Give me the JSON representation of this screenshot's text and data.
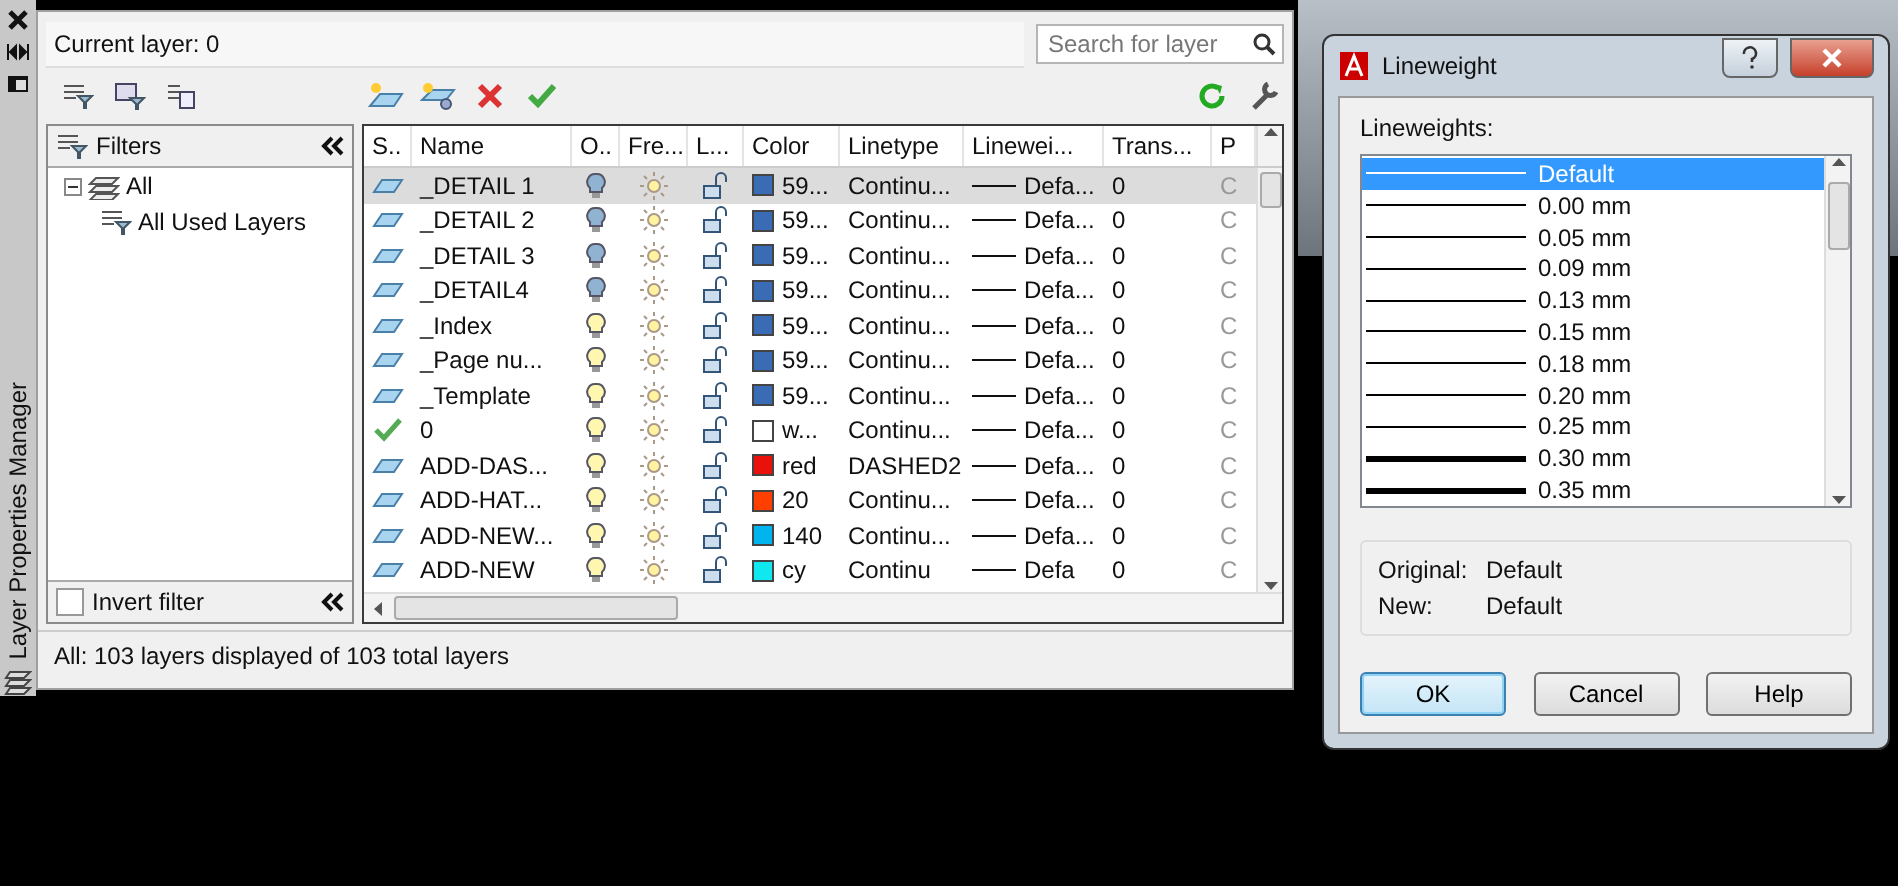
{
  "palette": {
    "side_title": "Layer Properties Manager",
    "current_layer": "Current layer: 0",
    "search": {
      "placeholder": "Search for layer"
    },
    "filters": {
      "title": "Filters",
      "tree": [
        {
          "label": "All",
          "expanded": true,
          "children": [
            {
              "label": "All Used Layers"
            }
          ]
        }
      ]
    },
    "invert_filter": {
      "label": "Invert filter",
      "checked": false
    },
    "columns": [
      "S..",
      "Name",
      "O..",
      "Fre...",
      "L...",
      "Color",
      "Linetype",
      "Linewei...",
      "Trans...",
      "P"
    ],
    "rows": [
      {
        "current": false,
        "name": "_DETAIL 1",
        "on": false,
        "frozen": false,
        "locked": false,
        "color": "#3a6bb5",
        "color_label": "59...",
        "linetype": "Continu...",
        "lineweight": "Defa...",
        "transparency": "0",
        "plot": "C",
        "selected": true
      },
      {
        "current": false,
        "name": "_DETAIL 2",
        "on": false,
        "frozen": false,
        "locked": false,
        "color": "#3a6bb5",
        "color_label": "59...",
        "linetype": "Continu...",
        "lineweight": "Defa...",
        "transparency": "0",
        "plot": "C",
        "selected": false
      },
      {
        "current": false,
        "name": "_DETAIL 3",
        "on": false,
        "frozen": false,
        "locked": false,
        "color": "#3a6bb5",
        "color_label": "59...",
        "linetype": "Continu...",
        "lineweight": "Defa...",
        "transparency": "0",
        "plot": "C",
        "selected": false
      },
      {
        "current": false,
        "name": "_DETAIL4",
        "on": false,
        "frozen": false,
        "locked": false,
        "color": "#3a6bb5",
        "color_label": "59...",
        "linetype": "Continu...",
        "lineweight": "Defa...",
        "transparency": "0",
        "plot": "C",
        "selected": false
      },
      {
        "current": false,
        "name": "_Index",
        "on": true,
        "frozen": false,
        "locked": false,
        "color": "#3a6bb5",
        "color_label": "59...",
        "linetype": "Continu...",
        "lineweight": "Defa...",
        "transparency": "0",
        "plot": "C",
        "selected": false
      },
      {
        "current": false,
        "name": "_Page nu...",
        "on": true,
        "frozen": false,
        "locked": false,
        "color": "#3a6bb5",
        "color_label": "59...",
        "linetype": "Continu...",
        "lineweight": "Defa...",
        "transparency": "0",
        "plot": "C",
        "selected": false
      },
      {
        "current": false,
        "name": "_Template",
        "on": true,
        "frozen": false,
        "locked": false,
        "color": "#3a6bb5",
        "color_label": "59...",
        "linetype": "Continu...",
        "lineweight": "Defa...",
        "transparency": "0",
        "plot": "C",
        "selected": false
      },
      {
        "current": true,
        "name": "0",
        "on": true,
        "frozen": false,
        "locked": false,
        "color": "#ffffff",
        "color_label": "w...",
        "linetype": "Continu...",
        "lineweight": "Defa...",
        "transparency": "0",
        "plot": "C",
        "selected": false
      },
      {
        "current": false,
        "name": "ADD-DAS...",
        "on": true,
        "frozen": false,
        "locked": false,
        "color": "#e8110c",
        "color_label": "red",
        "linetype": "DASHED2",
        "lineweight": "Defa...",
        "transparency": "0",
        "plot": "C",
        "selected": false
      },
      {
        "current": false,
        "name": "ADD-HAT...",
        "on": true,
        "frozen": false,
        "locked": false,
        "color": "#ff3f00",
        "color_label": "20",
        "linetype": "Continu...",
        "lineweight": "Defa...",
        "transparency": "0",
        "plot": "C",
        "selected": false
      },
      {
        "current": false,
        "name": "ADD-NEW...",
        "on": true,
        "frozen": false,
        "locked": false,
        "color": "#00b4ee",
        "color_label": "140",
        "linetype": "Continu...",
        "lineweight": "Defa...",
        "transparency": "0",
        "plot": "C",
        "selected": false
      },
      {
        "current": false,
        "name": "ADD-NEW",
        "on": true,
        "frozen": false,
        "locked": false,
        "color": "#10e8f0",
        "color_label": "cy",
        "linetype": "Continu",
        "lineweight": "Defa",
        "transparency": "0",
        "plot": "C",
        "selected": false
      }
    ],
    "status": "All: 103 layers displayed of 103 total layers"
  },
  "dialog": {
    "title": "Lineweight",
    "list_label": "Lineweights:",
    "items": [
      {
        "label": "Default",
        "kind": "thin",
        "selected": true
      },
      {
        "label": "0.00 mm",
        "kind": "thin",
        "selected": false
      },
      {
        "label": "0.05 mm",
        "kind": "thin",
        "selected": false
      },
      {
        "label": "0.09 mm",
        "kind": "thin",
        "selected": false
      },
      {
        "label": "0.13 mm",
        "kind": "thin",
        "selected": false
      },
      {
        "label": "0.15 mm",
        "kind": "thin",
        "selected": false
      },
      {
        "label": "0.18 mm",
        "kind": "thin",
        "selected": false
      },
      {
        "label": "0.20 mm",
        "kind": "thin",
        "selected": false
      },
      {
        "label": "0.25 mm",
        "kind": "thin",
        "selected": false
      },
      {
        "label": "0.30 mm",
        "kind": "thick",
        "selected": false
      },
      {
        "label": "0.35 mm",
        "kind": "thick",
        "selected": false
      }
    ],
    "info": [
      {
        "label": "Original:",
        "value": "Default"
      },
      {
        "label": "New:",
        "value": "Default"
      }
    ],
    "buttons": [
      {
        "label": "OK",
        "focused": true
      },
      {
        "label": "Cancel",
        "focused": false
      },
      {
        "label": "Help",
        "focused": false
      }
    ]
  }
}
